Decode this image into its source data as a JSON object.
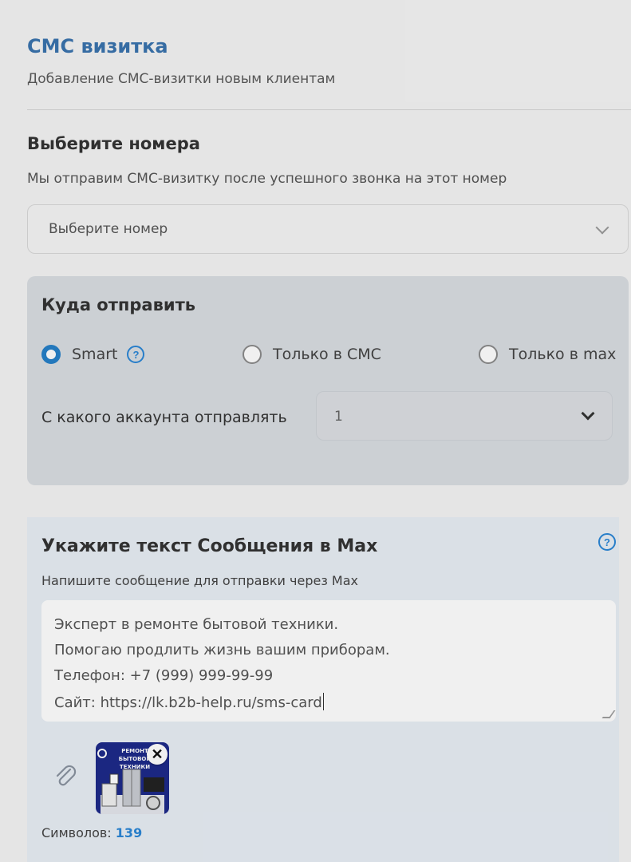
{
  "header": {
    "title": "СМС визитка",
    "subtitle": "Добавление СМС-визитки новым клиентам"
  },
  "numbers": {
    "title": "Выберите номера",
    "subtitle": "Мы отправим СМС-визитку после успешного звонка на этот номер",
    "select_placeholder": "Выберите номер"
  },
  "send_to": {
    "title": "Куда отправить",
    "options": [
      {
        "label": "Smart",
        "selected": true
      },
      {
        "label": "Только в СМС",
        "selected": false
      },
      {
        "label": "Только в max",
        "selected": false
      }
    ],
    "account_label": "С какого аккаунта отправлять",
    "account_value": "1"
  },
  "max_message": {
    "title": "Укажите текст Сообщения в Max",
    "subtitle": "Напишите сообщение для отправки через Max",
    "lines": [
      "Эксперт в ремонте бытовой техники.",
      "Помогаю продлить жизнь вашим приборам.",
      "Телефон: +7 (999) 999-99-99",
      "Сайт: https://lk.b2b-help.ru/sms-card"
    ],
    "attachment_text": "РЕМОНТ БЫТОВОЙ ТЕХНИКИ",
    "chars_label": "Символов:",
    "chars_count": "139"
  },
  "icons": {
    "help": "question-circle-icon",
    "chevron": "chevron-down-icon",
    "clip": "paperclip-icon",
    "close": "close-icon"
  },
  "colors": {
    "accent": "#2b86d6",
    "title_blue": "#3a73ae",
    "card_bg": "#d9dde2",
    "max_card_bg": "#e8eef5"
  }
}
